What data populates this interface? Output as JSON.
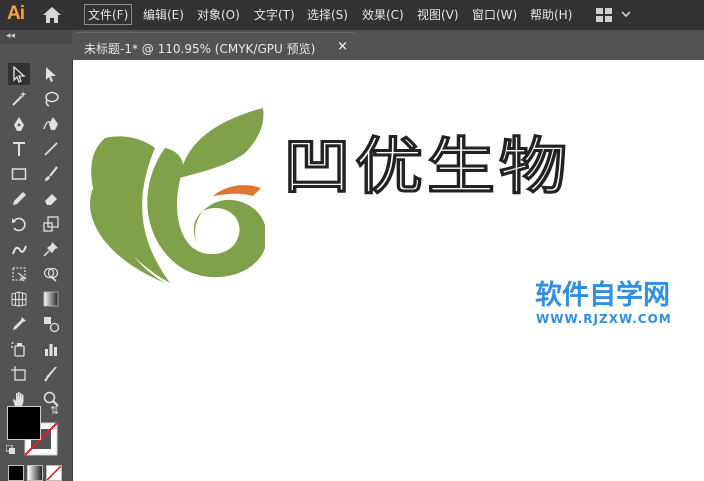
{
  "app": {
    "logo": "Ai",
    "menu": [
      "文件(F)",
      "编辑(E)",
      "对象(O)",
      "文字(T)",
      "选择(S)",
      "效果(C)",
      "视图(V)",
      "窗口(W)",
      "帮助(H)"
    ],
    "active_menu_index": 0
  },
  "toolbar": {
    "collapse": "◂◂",
    "tools": [
      "selection-tool",
      "direct-selection-tool",
      "magic-wand-tool",
      "lasso-tool",
      "pen-tool",
      "curvature-tool",
      "type-tool",
      "line-segment-tool",
      "rectangle-tool",
      "paintbrush-tool",
      "shaper-tool",
      "eraser-tool",
      "rotate-tool",
      "scale-tool",
      "warp-tool",
      "puppet-warp-tool",
      "free-transform-tool",
      "shape-builder-tool",
      "perspective-grid-tool",
      "gradient-tool",
      "mesh-tool",
      "live-paint-tool",
      "eyedropper-tool",
      "blend-tool",
      "symbol-sprayer-tool",
      "column-graph-tool",
      "artboard-tool",
      "slice-tool",
      "hand-tool",
      "zoom-tool"
    ],
    "swap_icon": "⇅"
  },
  "document_tab": {
    "title": "未标题-1* @ 110.95% (CMYK/GPU 预览)",
    "close": "×"
  },
  "canvas": {
    "company_name": "凹优生物",
    "watermark_title": "软件自学网",
    "watermark_url": "WWW.RJZXW.COM",
    "logo_green": "#7fa14a",
    "logo_orange": "#e0772f",
    "watermark_color": "#2f8fe3"
  },
  "colors": {
    "menubar": "#323232",
    "panel": "#535353",
    "canvas": "#ffffff"
  }
}
